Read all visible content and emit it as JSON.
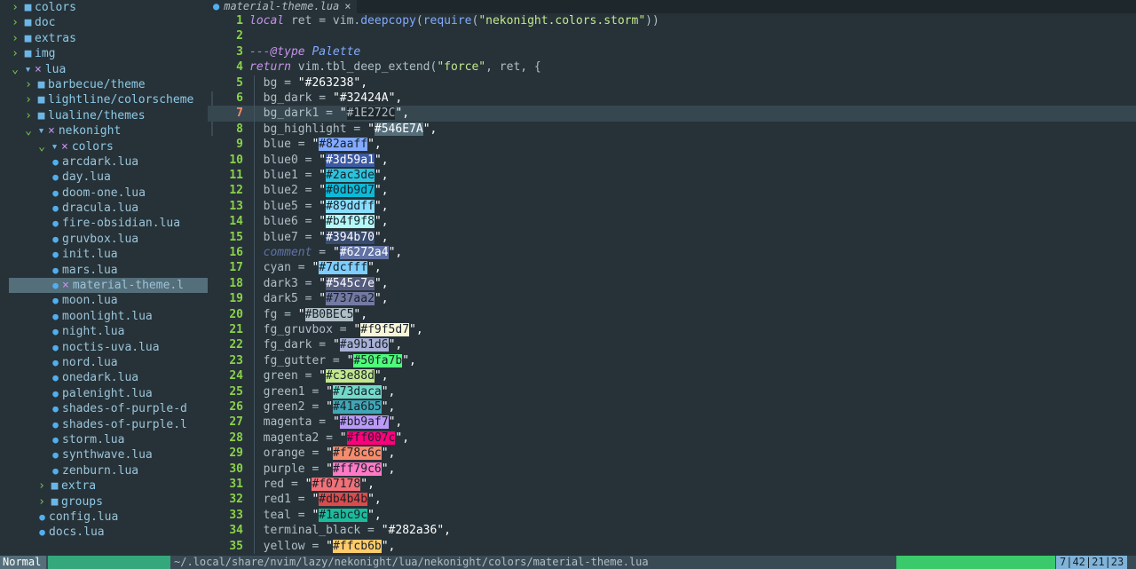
{
  "sidebar": {
    "items": [
      {
        "depth": 0,
        "kind": "dir",
        "open": false,
        "modified": false,
        "label": "colors"
      },
      {
        "depth": 0,
        "kind": "dir",
        "open": false,
        "modified": false,
        "label": "doc"
      },
      {
        "depth": 0,
        "kind": "dir",
        "open": false,
        "modified": false,
        "label": "extras"
      },
      {
        "depth": 0,
        "kind": "dir",
        "open": false,
        "modified": false,
        "label": "img"
      },
      {
        "depth": 0,
        "kind": "dir",
        "open": true,
        "modified": true,
        "label": "lua"
      },
      {
        "depth": 1,
        "kind": "dir",
        "open": false,
        "modified": false,
        "label": "barbecue/theme"
      },
      {
        "depth": 1,
        "kind": "dir",
        "open": false,
        "modified": false,
        "label": "lightline/colorscheme"
      },
      {
        "depth": 1,
        "kind": "dir",
        "open": false,
        "modified": false,
        "label": "lualine/themes"
      },
      {
        "depth": 1,
        "kind": "dir",
        "open": true,
        "modified": true,
        "label": "nekonight"
      },
      {
        "depth": 2,
        "kind": "dir",
        "open": true,
        "modified": true,
        "label": "colors"
      },
      {
        "depth": 3,
        "kind": "file",
        "label": "arcdark.lua"
      },
      {
        "depth": 3,
        "kind": "file",
        "label": "day.lua"
      },
      {
        "depth": 3,
        "kind": "file",
        "label": "doom-one.lua"
      },
      {
        "depth": 3,
        "kind": "file",
        "label": "dracula.lua"
      },
      {
        "depth": 3,
        "kind": "file",
        "label": "fire-obsidian.lua"
      },
      {
        "depth": 3,
        "kind": "file",
        "label": "gruvbox.lua"
      },
      {
        "depth": 3,
        "kind": "file",
        "label": "init.lua"
      },
      {
        "depth": 3,
        "kind": "file",
        "label": "mars.lua"
      },
      {
        "depth": 3,
        "kind": "file",
        "modified": true,
        "active": true,
        "label": "material-theme.l"
      },
      {
        "depth": 3,
        "kind": "file",
        "label": "moon.lua"
      },
      {
        "depth": 3,
        "kind": "file",
        "label": "moonlight.lua"
      },
      {
        "depth": 3,
        "kind": "file",
        "label": "night.lua"
      },
      {
        "depth": 3,
        "kind": "file",
        "label": "noctis-uva.lua"
      },
      {
        "depth": 3,
        "kind": "file",
        "label": "nord.lua"
      },
      {
        "depth": 3,
        "kind": "file",
        "label": "onedark.lua"
      },
      {
        "depth": 3,
        "kind": "file",
        "label": "palenight.lua"
      },
      {
        "depth": 3,
        "kind": "file",
        "label": "shades-of-purple-d"
      },
      {
        "depth": 3,
        "kind": "file",
        "label": "shades-of-purple.l"
      },
      {
        "depth": 3,
        "kind": "file",
        "label": "storm.lua"
      },
      {
        "depth": 3,
        "kind": "file",
        "label": "synthwave.lua"
      },
      {
        "depth": 3,
        "kind": "file",
        "label": "zenburn.lua"
      },
      {
        "depth": 2,
        "kind": "dir",
        "open": false,
        "modified": false,
        "label": "extra"
      },
      {
        "depth": 2,
        "kind": "dir",
        "open": false,
        "modified": false,
        "label": "groups"
      },
      {
        "depth": 2,
        "kind": "file",
        "label": "config.lua"
      },
      {
        "depth": 2,
        "kind": "file",
        "label": "docs.lua"
      }
    ]
  },
  "tab": {
    "title": "material-theme.lua",
    "close": "×",
    "icon": "lua-file-icon"
  },
  "editor": {
    "cursor_line": 7,
    "lines": [
      {
        "n": "1",
        "tokens": [
          [
            "kw",
            "local"
          ],
          [
            "key",
            " ret = vim."
          ],
          [
            "fn",
            "deepcopy"
          ],
          [
            "key",
            "("
          ],
          [
            "fn",
            "require"
          ],
          [
            "key",
            "("
          ],
          [
            "str",
            "\"nekonight.colors.storm\""
          ],
          [
            "key",
            "))"
          ]
        ]
      },
      {
        "n": "2",
        "tokens": []
      },
      {
        "n": "3",
        "tokens": [
          [
            "cmt",
            "---"
          ],
          [
            "tag",
            "@type"
          ],
          [
            "typ",
            " Palette"
          ]
        ]
      },
      {
        "n": "4",
        "tokens": [
          [
            "kw",
            "return"
          ],
          [
            "key",
            " vim.tbl_deep_extend("
          ],
          [
            "str",
            "\"force\""
          ],
          [
            "key",
            ", ret, {"
          ]
        ]
      },
      {
        "n": "5",
        "prop": "bg",
        "hex": "#263238",
        "swatch": false
      },
      {
        "n": "6",
        "prop": "bg_dark",
        "hex": "#32424A",
        "swatch": false
      },
      {
        "n": "7",
        "prop": "bg_dark1",
        "hex": "#1E272C",
        "swatch": true,
        "fg": "#b0bec5"
      },
      {
        "n": "8",
        "prop": "bg_highlight",
        "hex": "#546E7A",
        "swatch": true,
        "fg": "#ffffff"
      },
      {
        "n": "9",
        "prop": "blue",
        "hex": "#82aaff",
        "swatch": true,
        "fg": "#17212a"
      },
      {
        "n": "10",
        "prop": "blue0",
        "hex": "#3d59a1",
        "swatch": true,
        "fg": "#ffffff"
      },
      {
        "n": "11",
        "prop": "blue1",
        "hex": "#2ac3de",
        "swatch": true,
        "fg": "#17212a"
      },
      {
        "n": "12",
        "prop": "blue2",
        "hex": "#0db9d7",
        "swatch": true,
        "fg": "#17212a"
      },
      {
        "n": "13",
        "prop": "blue5",
        "hex": "#89ddff",
        "swatch": true,
        "fg": "#17212a"
      },
      {
        "n": "14",
        "prop": "blue6",
        "hex": "#b4f9f8",
        "swatch": true,
        "fg": "#17212a"
      },
      {
        "n": "15",
        "prop": "blue7",
        "hex": "#394b70",
        "swatch": true,
        "fg": "#ffffff"
      },
      {
        "n": "16",
        "prop": "comment",
        "hex": "#6272a4",
        "swatch": true,
        "fg": "#ffffff",
        "italic": true
      },
      {
        "n": "17",
        "prop": "cyan",
        "hex": "#7dcfff",
        "swatch": true,
        "fg": "#17212a"
      },
      {
        "n": "18",
        "prop": "dark3",
        "hex": "#545c7e",
        "swatch": true,
        "fg": "#ffffff"
      },
      {
        "n": "19",
        "prop": "dark5",
        "hex": "#737aa2",
        "swatch": true,
        "fg": "#17212a"
      },
      {
        "n": "20",
        "prop": "fg",
        "hex": "#B0BEC5",
        "swatch": true,
        "fg": "#17212a"
      },
      {
        "n": "21",
        "prop": "fg_gruvbox",
        "hex": "#f9f5d7",
        "swatch": true,
        "fg": "#17212a"
      },
      {
        "n": "22",
        "prop": "fg_dark",
        "hex": "#a9b1d6",
        "swatch": true,
        "fg": "#17212a"
      },
      {
        "n": "23",
        "prop": "fg_gutter",
        "hex": "#50fa7b",
        "swatch": true,
        "fg": "#17212a"
      },
      {
        "n": "24",
        "prop": "green",
        "hex": "#c3e88d",
        "swatch": true,
        "fg": "#17212a"
      },
      {
        "n": "25",
        "prop": "green1",
        "hex": "#73daca",
        "swatch": true,
        "fg": "#17212a"
      },
      {
        "n": "26",
        "prop": "green2",
        "hex": "#41a6b5",
        "swatch": true,
        "fg": "#17212a"
      },
      {
        "n": "27",
        "prop": "magenta",
        "hex": "#bb9af7",
        "swatch": true,
        "fg": "#17212a"
      },
      {
        "n": "28",
        "prop": "magenta2",
        "hex": "#ff007c",
        "swatch": true,
        "fg": "#17212a"
      },
      {
        "n": "29",
        "prop": "orange",
        "hex": "#f78c6c",
        "swatch": true,
        "fg": "#17212a"
      },
      {
        "n": "30",
        "prop": "purple",
        "hex": "#ff79c6",
        "swatch": true,
        "fg": "#17212a"
      },
      {
        "n": "31",
        "prop": "red",
        "hex": "#f07178",
        "swatch": true,
        "fg": "#17212a"
      },
      {
        "n": "32",
        "prop": "red1",
        "hex": "#db4b4b",
        "swatch": true,
        "fg": "#17212a"
      },
      {
        "n": "33",
        "prop": "teal",
        "hex": "#1abc9c",
        "swatch": true,
        "fg": "#17212a"
      },
      {
        "n": "34",
        "prop": "terminal_black",
        "hex": "#282a36",
        "swatch": false
      },
      {
        "n": "35",
        "prop": "yellow",
        "hex": "#ffcb6b",
        "swatch": true,
        "fg": "#17212a"
      }
    ]
  },
  "status": {
    "mode": "Normal",
    "branch": "",
    "path": "~/.local/share/nvim/lazy/nekonight/lua/nekonight/colors/material-theme.lua",
    "lsp": "",
    "position": "7|42|21|23"
  }
}
